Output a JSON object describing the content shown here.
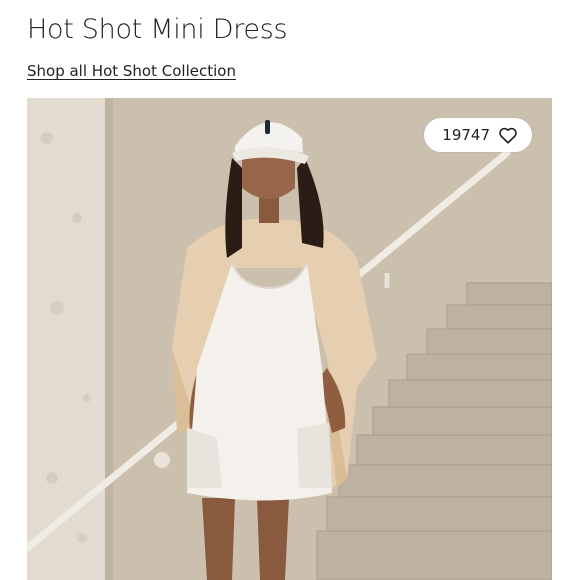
{
  "product": {
    "title": "Hot Shot Mini Dress",
    "collection_link": "Shop all Hot Shot Collection"
  },
  "image": {
    "likes_count": "19747",
    "like_icon": "heart-outline-icon"
  },
  "colors": {
    "text": "#222222",
    "background": "#ffffff",
    "pill": "#ffffff"
  }
}
